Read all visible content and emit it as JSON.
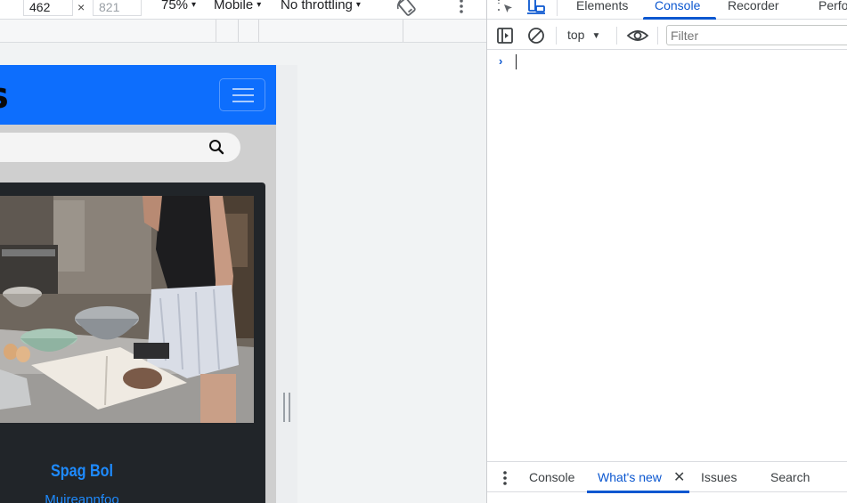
{
  "emulation_toolbar": {
    "width_value": "462",
    "height_placeholder": "821",
    "dimension_separator": "×",
    "zoom_label": "75%",
    "device_label": "Mobile",
    "throttling_label": "No throttling",
    "dropdown_caret": "▾"
  },
  "emulated_page": {
    "brand_text": "s",
    "card": {
      "title": "Spag Bol",
      "author": "Muireannfoo"
    }
  },
  "devtools": {
    "tabs": [
      "Elements",
      "Console",
      "Recorder",
      "Perfo"
    ],
    "active_tab": "Console",
    "console_toolbar": {
      "context_label": "top",
      "context_caret": "▼",
      "filter_placeholder": "Filter"
    },
    "prompt_symbol": "›",
    "drawer": {
      "tabs": [
        "Console",
        "What's new",
        "Issues",
        "Search"
      ],
      "active_tab": "What's new",
      "close_symbol": "✕"
    }
  },
  "colors": {
    "header_blue": "#0d6efd",
    "card_dark": "#212529",
    "link_blue": "#1e8bff",
    "devtools_accent": "#0b57d0"
  }
}
